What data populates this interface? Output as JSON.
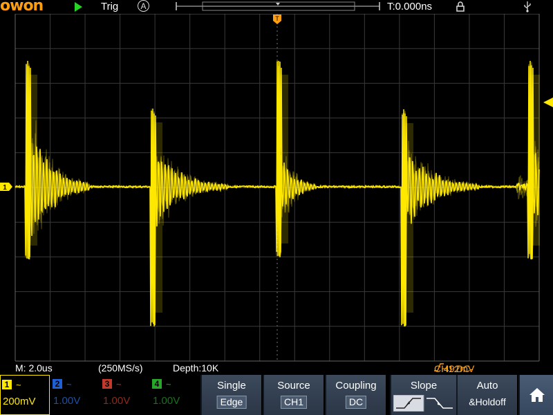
{
  "topbar": {
    "logo": "owon",
    "run_state_icon": "play-icon",
    "trigger_status": "Trig",
    "trigger_mode_icon": "A",
    "trigger_time": "T:0.000ns",
    "lock_icon": "lock-icon",
    "usb_icon": "usb-icon"
  },
  "status": {
    "timebase": "M: 2.0us",
    "sample_rate": "(250MS/s)",
    "depth": "Depth:10K",
    "trigger_prefix": "CH1:DC-",
    "trigger_level": "492mV"
  },
  "channels": [
    {
      "num": "1",
      "coupling": "~",
      "volts": "200mV",
      "color": "#ffe800",
      "active": true
    },
    {
      "num": "2",
      "coupling": "~",
      "volts": "1.00V",
      "color": "#1f5fd6",
      "active": false
    },
    {
      "num": "3",
      "coupling": "~",
      "volts": "1.00V",
      "color": "#c0392b",
      "active": false
    },
    {
      "num": "4",
      "coupling": "~",
      "volts": "1.00V",
      "color": "#27a72a",
      "active": false
    }
  ],
  "menu": {
    "type_title": "Single",
    "type_value": "Edge",
    "source_title": "Source",
    "source_value": "CH1",
    "coupling_title": "Coupling",
    "coupling_value": "DC",
    "slope_title": "Slope",
    "mode_title": "Auto",
    "mode_value": "&Holdoff",
    "home_icon": "home-icon"
  },
  "markers": {
    "channel_marker": "1",
    "trigger_position_marker": "T"
  },
  "colors": {
    "accent": "#ff9f10",
    "trace": "#ffe800",
    "grid": "#3a3a3a"
  }
}
